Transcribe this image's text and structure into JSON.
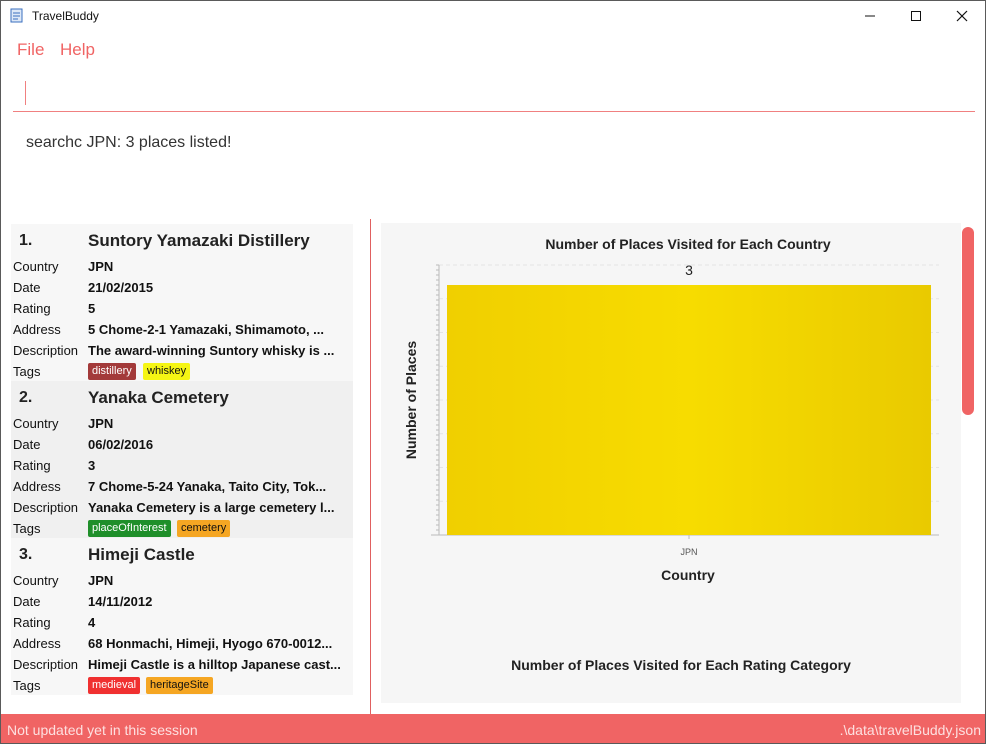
{
  "window": {
    "title": "TravelBuddy"
  },
  "menu": {
    "file": "File",
    "help": "Help"
  },
  "command": {
    "value": ""
  },
  "result_message": "searchc JPN: 3 places listed!",
  "labels": {
    "country": "Country",
    "date": "Date",
    "rating": "Rating",
    "address": "Address",
    "description": "Description",
    "tags": "Tags"
  },
  "places": [
    {
      "index": "1.",
      "name": "Suntory Yamazaki Distillery",
      "country": "JPN",
      "date": "21/02/2015",
      "rating": "5",
      "address": "5 Chome-2-1 Yamazaki, Shimamoto, ...",
      "description": "The award-winning Suntory whisky is ...",
      "tags": [
        "distillery",
        "whiskey"
      ]
    },
    {
      "index": "2.",
      "name": "Yanaka Cemetery",
      "country": "JPN",
      "date": "06/02/2016",
      "rating": "3",
      "address": "7 Chome-5-24 Yanaka, Taito City, Tok...",
      "description": "Yanaka Cemetery is a large cemetery l...",
      "tags": [
        "placeOfInterest",
        "cemetery"
      ]
    },
    {
      "index": "3.",
      "name": "Himeji Castle",
      "country": "JPN",
      "date": "14/11/2012",
      "rating": "4",
      "address": "68 Honmachi, Himeji, Hyogo 670-0012...",
      "description": "Himeji Castle is a hilltop Japanese cast...",
      "tags": [
        "medieval",
        "heritageSite"
      ]
    }
  ],
  "tag_colors": {
    "distillery": "#a33a3a",
    "whiskey": "#f5f514",
    "placeOfInterest": "#1f8f2a",
    "cemetery": "#f5a623",
    "medieval": "#f03030",
    "heritageSite": "#f5a623"
  },
  "chart_data": [
    {
      "type": "bar",
      "title": "Number of Places Visited for Each Country",
      "xlabel": "Country",
      "ylabel": "Number of Places",
      "categories": [
        "JPN"
      ],
      "values": [
        3
      ],
      "data_labels": [
        "3"
      ],
      "color": "#f0cf00",
      "grid": true
    },
    {
      "type": "bar",
      "title": "Number of Places Visited for Each Rating Category"
    }
  ],
  "status": {
    "left": "Not updated yet in this session",
    "right": ".\\data\\travelBuddy.json"
  },
  "colors": {
    "accent": "#f06464"
  }
}
